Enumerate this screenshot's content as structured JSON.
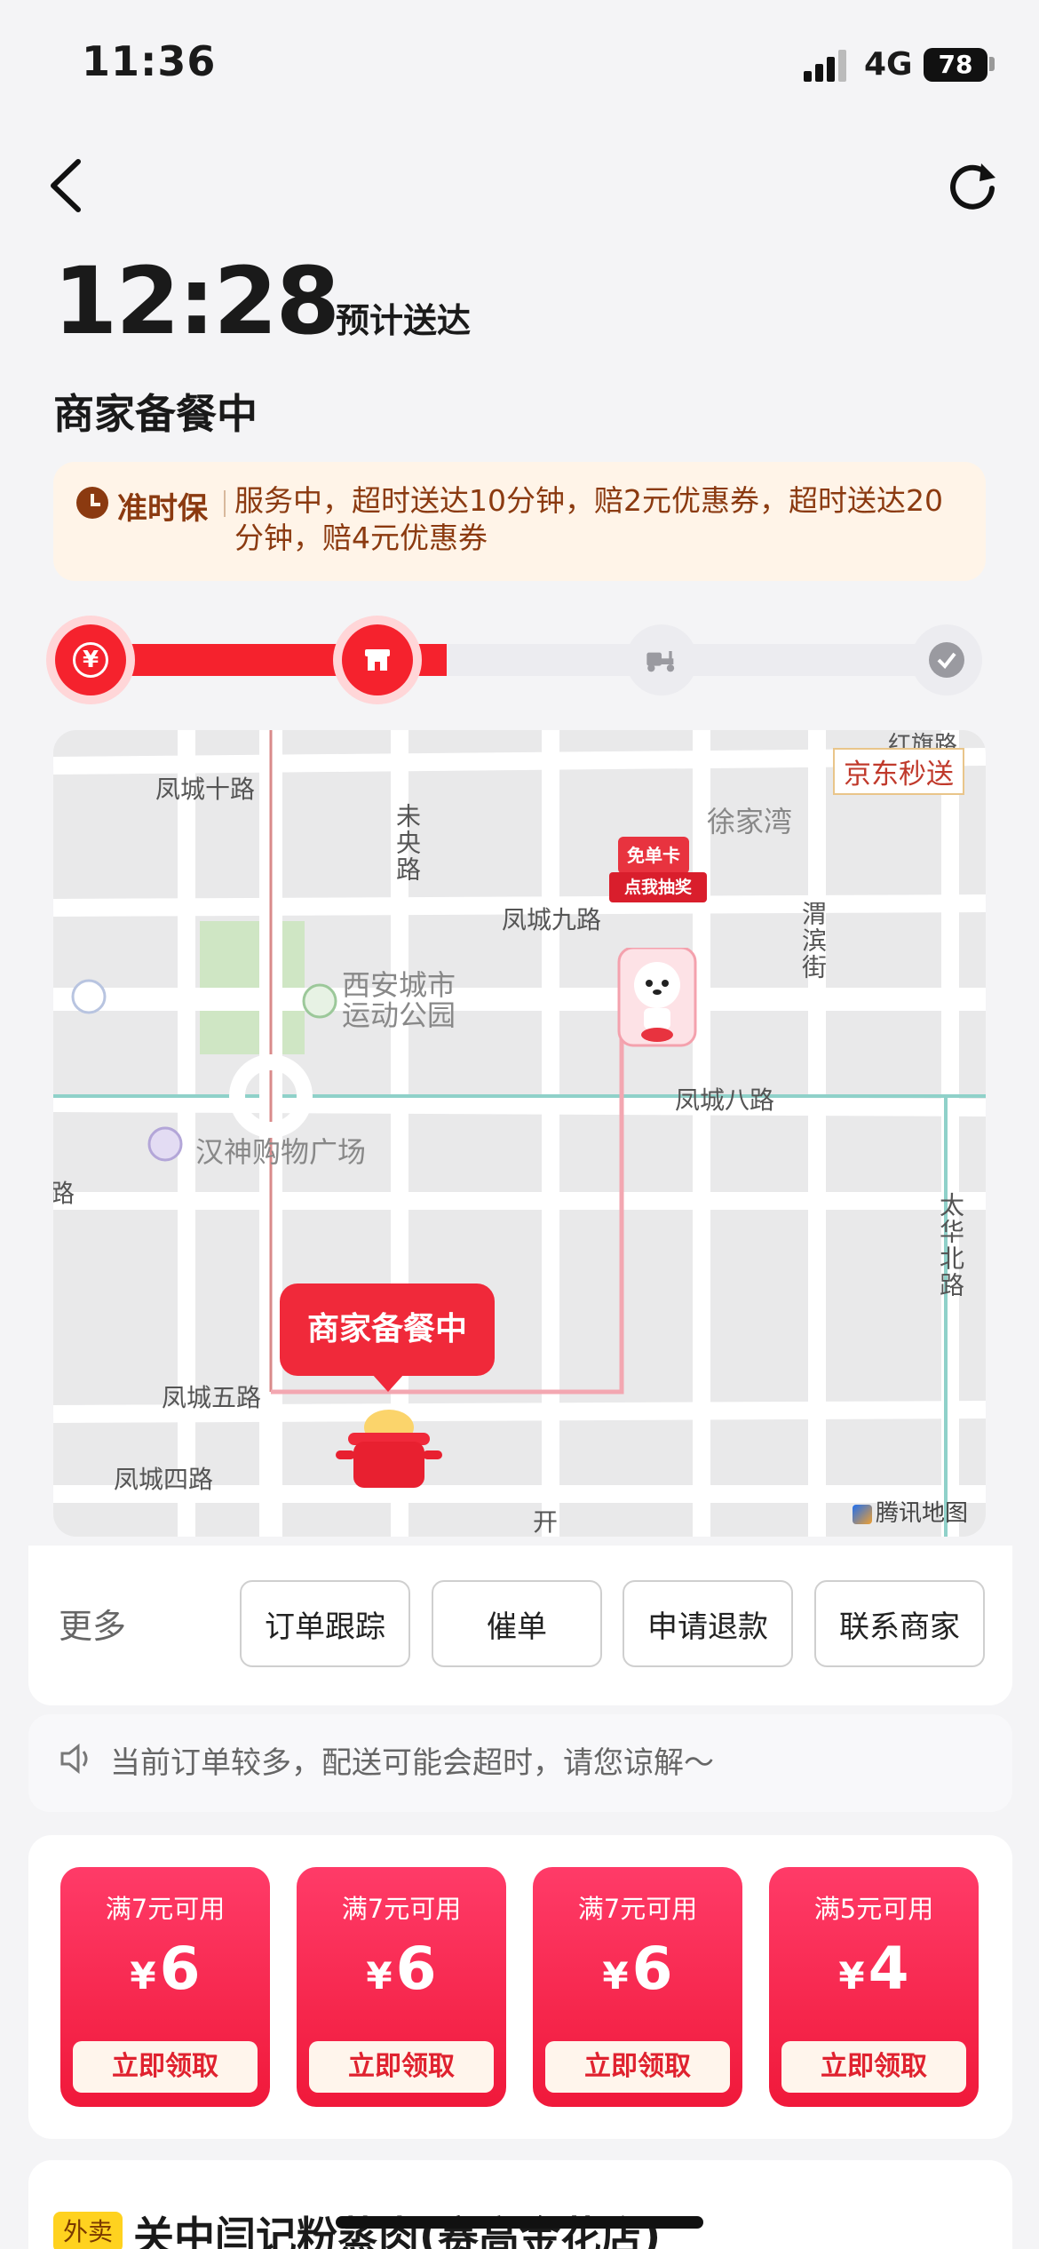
{
  "status_bar": {
    "time": "11:36",
    "network": "4G",
    "battery": "78"
  },
  "header": {
    "eta_time": "12:28",
    "eta_label": "预计送达",
    "status": "商家备餐中"
  },
  "ontime": {
    "label": "准时保",
    "text": "服务中，超时送达10分钟，赔2元优惠券，超时送达20分钟，赔4元优惠券"
  },
  "progress": {
    "steps": [
      "paid",
      "merchant",
      "delivery",
      "done"
    ],
    "current_step": 2,
    "fill_fraction": 0.42,
    "yen_symbol": "¥"
  },
  "map": {
    "badge": "京东秒送",
    "provider": "腾讯地图",
    "callout": "商家备餐中",
    "roads": {
      "fengcheng10": "凤城十路",
      "weiyang": "未央路",
      "xujiawan": "徐家湾",
      "hongqi": "红旗路",
      "fengcheng9": "凤城九路",
      "weibin": "渭滨街",
      "park": "西安城市运动公园",
      "fengcheng8": "凤城八路",
      "hanshen": "汉神购物广场",
      "taihua": "太华北路",
      "fengcheng5": "凤城五路",
      "fengcheng4": "凤城四路",
      "kai": "开",
      "lu": "路"
    },
    "promo_top": "免单卡",
    "promo_bottom": "点我抽奖"
  },
  "actions": {
    "more": "更多",
    "buttons": [
      "订单跟踪",
      "催单",
      "申请退款",
      "联系商家"
    ]
  },
  "notice": {
    "text": "当前订单较多，配送可能会超时，请您谅解～"
  },
  "coupons": [
    {
      "condition": "满7元可用",
      "currency": "¥",
      "amount": "6",
      "button": "立即领取"
    },
    {
      "condition": "满7元可用",
      "currency": "¥",
      "amount": "6",
      "button": "立即领取"
    },
    {
      "condition": "满7元可用",
      "currency": "¥",
      "amount": "6",
      "button": "立即领取"
    },
    {
      "condition": "满5元可用",
      "currency": "¥",
      "amount": "4",
      "button": "立即领取"
    }
  ],
  "store": {
    "tag": "外卖",
    "name": "关中闫记粉蒸肉(赛高金花店)"
  },
  "colors": {
    "primary_red": "#f5222d",
    "ontime_brown": "#8b3a10",
    "ontime_bg": "#fff4e8"
  }
}
